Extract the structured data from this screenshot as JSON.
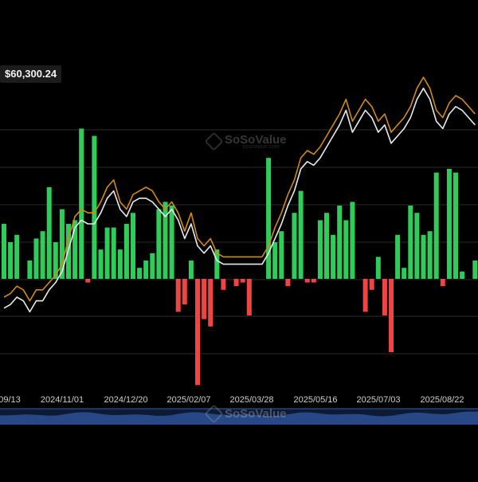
{
  "price_label": "$60,300.24",
  "watermark": {
    "brand": "SoSoValue",
    "sub": "sosovalue.com"
  },
  "colors": {
    "background": "#000000",
    "inflow": "#2ecc58",
    "outflow": "#ef4444",
    "line_a": "#d18a15",
    "line_b": "#eaeaea",
    "navigator": "#2a4d8f",
    "grid": "#2c2c2c",
    "text": "#cfcfcf"
  },
  "chart_data": {
    "type": "bar",
    "title": "",
    "xlabel": "",
    "ylabel": "",
    "grid": true,
    "x_tick_labels": [
      "09/13",
      "2024/11/01",
      "2024/12/20",
      "2025/02/07",
      "2025/03/28",
      "2025/05/16",
      "2025/07/03",
      "2025/08/22"
    ],
    "bars": [
      15,
      10,
      12,
      0,
      5,
      11,
      13,
      25,
      10,
      19,
      15,
      16,
      41,
      -1,
      39,
      8,
      14,
      14,
      8,
      15,
      18,
      3,
      5,
      7,
      19,
      21,
      20,
      -9,
      -7,
      5,
      -29,
      -11,
      -13,
      8,
      -3,
      0,
      -2,
      -1,
      -10,
      0,
      0,
      33,
      10,
      13,
      -2,
      18,
      24,
      -1,
      -1,
      16,
      18,
      12,
      20,
      16,
      21,
      0,
      -9,
      -3,
      6,
      -10,
      -20,
      12,
      3,
      20,
      18,
      12,
      13,
      29,
      -2,
      30,
      29,
      2,
      0,
      5
    ],
    "series": [
      {
        "values": [
          -5,
          -4,
          -2,
          -3,
          -6,
          -3,
          -3,
          -1,
          1,
          4,
          11,
          17,
          19,
          18,
          18,
          21,
          25,
          27,
          21,
          19,
          23,
          24,
          25,
          24,
          21,
          19,
          21,
          18,
          13,
          18,
          11,
          9,
          11,
          7,
          6,
          6,
          6,
          6,
          6,
          6,
          6,
          9,
          14,
          18,
          23,
          27,
          33,
          35,
          34,
          36,
          39,
          42,
          45,
          49,
          43,
          46,
          49,
          47,
          43,
          45,
          40,
          42,
          44,
          47,
          52,
          55,
          52,
          46,
          44,
          48,
          50,
          49,
          47,
          45
        ]
      },
      {
        "values": [
          -8,
          -7,
          -5,
          -6,
          -9,
          -6,
          -6,
          -3,
          -1,
          2,
          8,
          14,
          16,
          15,
          15,
          18,
          22,
          24,
          19,
          17,
          21,
          22,
          22,
          21,
          19,
          17,
          19,
          16,
          11,
          15,
          9,
          7,
          9,
          5,
          4,
          4,
          4,
          4,
          4,
          4,
          4,
          7,
          11,
          15,
          20,
          24,
          30,
          32,
          31,
          33,
          36,
          39,
          42,
          46,
          40,
          43,
          46,
          44,
          40,
          42,
          37,
          39,
          41,
          44,
          49,
          52,
          49,
          43,
          41,
          45,
          47,
          46,
          44,
          42
        ]
      }
    ],
    "ylim": [
      -50,
      65
    ]
  }
}
